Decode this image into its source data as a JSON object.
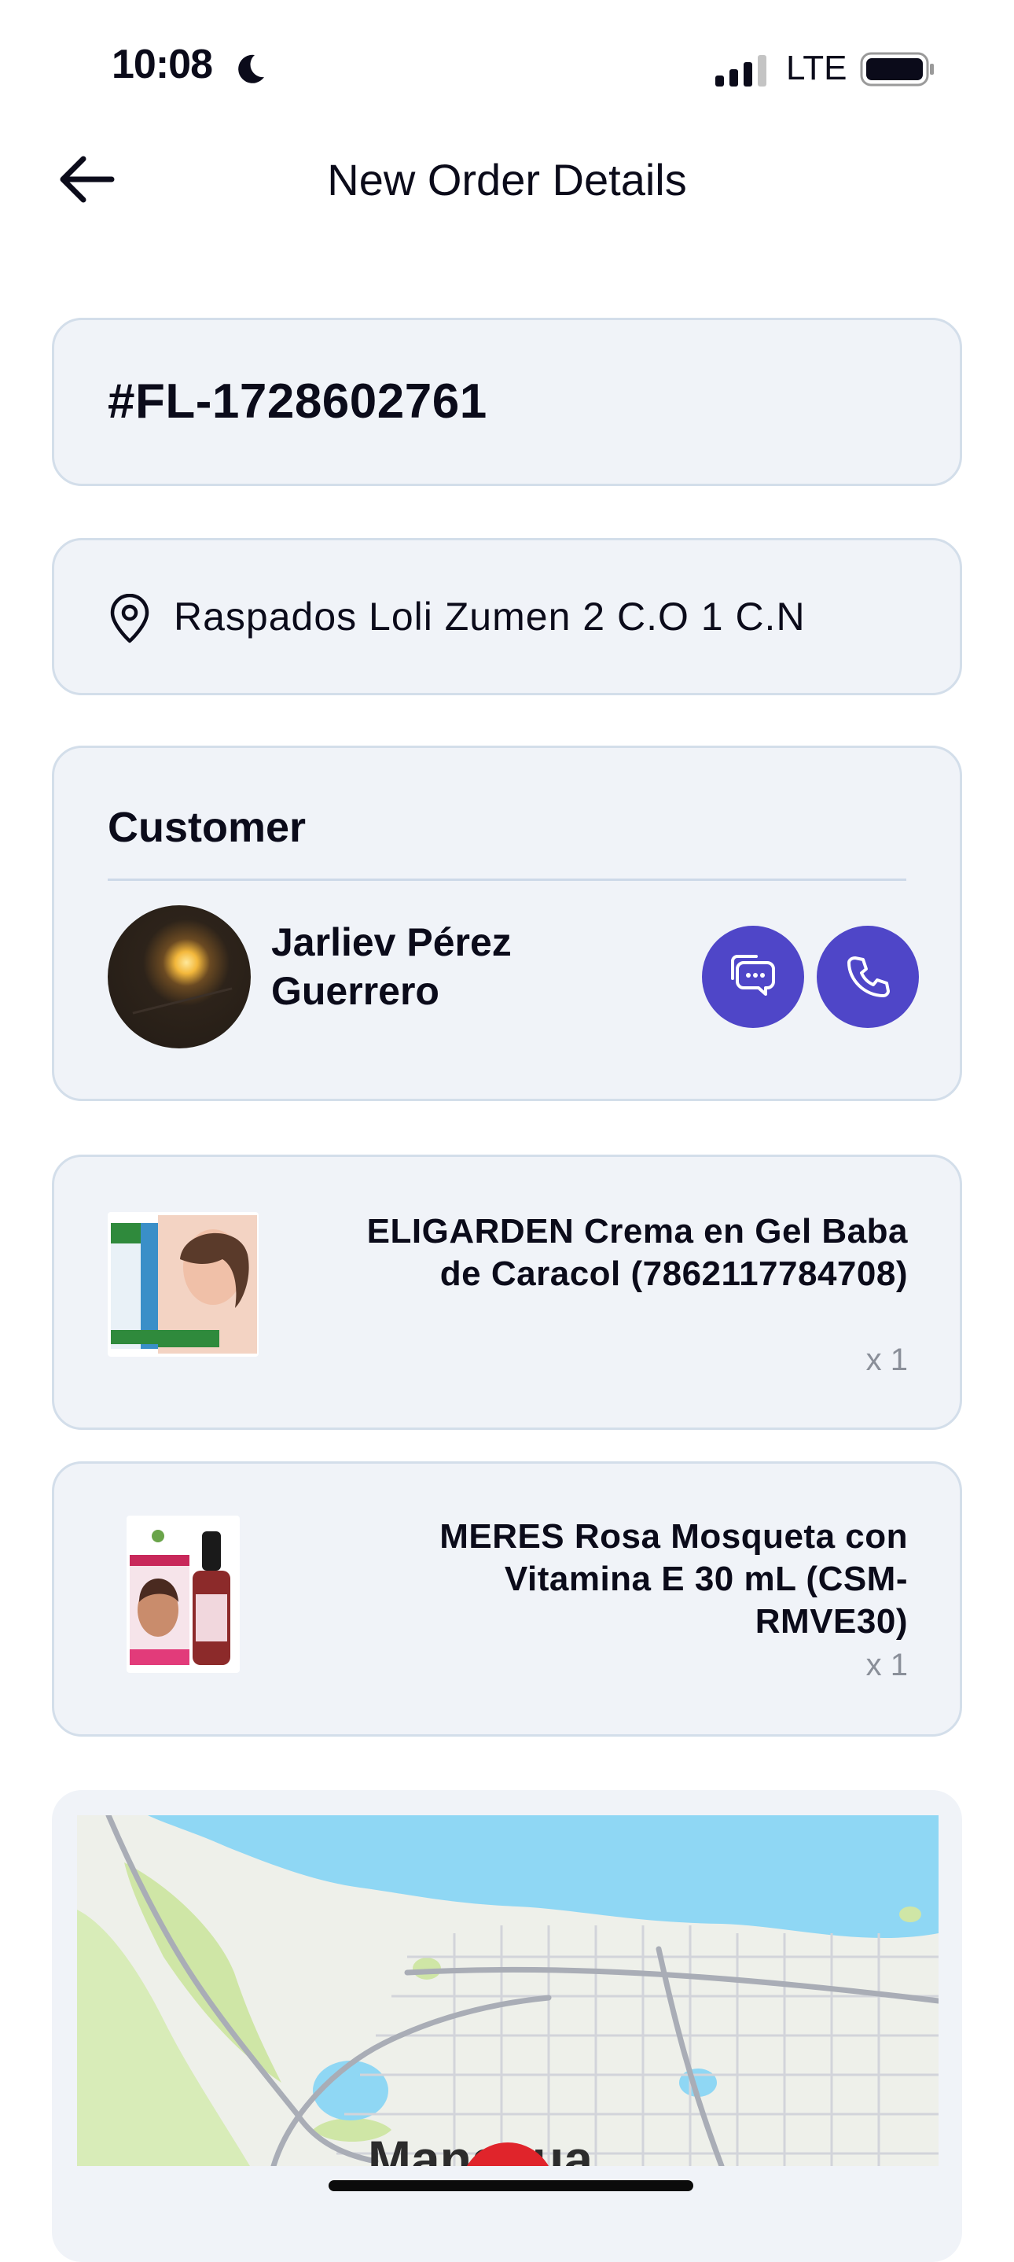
{
  "status_bar": {
    "time": "10:08",
    "network": "LTE"
  },
  "header": {
    "title": "New Order Details"
  },
  "order": {
    "id": "#FL-1728602761"
  },
  "address": {
    "text": "Raspados Loli Zumen 2 C.O 1 C.N"
  },
  "customer": {
    "section_title": "Customer",
    "name": "Jarliev Pérez Guerrero"
  },
  "products": [
    {
      "name": "ELIGARDEN Crema en Gel Baba de Caracol (7862117784708)",
      "qty": "x 1"
    },
    {
      "name": "MERES Rosa Mosqueta con Vitamina E 30 mL (CSM-RMVE30)",
      "qty": "x 1"
    }
  ],
  "map": {
    "city_label": "Managua"
  },
  "colors": {
    "accent": "#4f46c8",
    "card_bg": "#f0f3f8",
    "card_border": "#d3deea"
  }
}
